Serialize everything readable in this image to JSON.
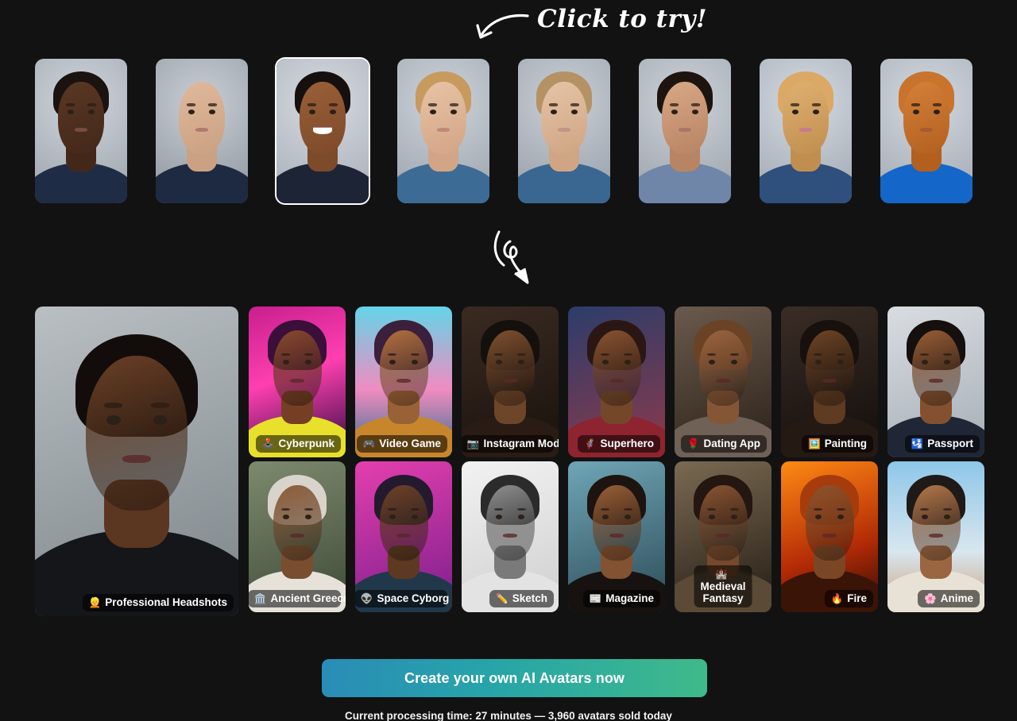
{
  "hint": {
    "text": "Click to try!",
    "arrow_icon": "curved-arrow-left-down-icon",
    "down_arrow_icon": "curly-arrow-down-icon"
  },
  "thumbnails": [
    {
      "name": "man-dark-skin-navy-tee",
      "selected": false,
      "bg1": "#cfd4da",
      "bg2": "#9aa2ab",
      "skin": "#5a3723",
      "skin2": "#43281a",
      "hair": "#1b1310",
      "shirt": "#1f2c45",
      "mouth": "#7a4a46",
      "smile": false
    },
    {
      "name": "man-blond-navy-tee",
      "selected": false,
      "bg1": "#c9ced5",
      "bg2": "#8d949d",
      "skin": "#e0b89b",
      "skin2": "#caa182",
      "hair": "#a5impossible",
      "shirt": "#1d2a42",
      "mouth": "#b07a6e",
      "smile": false
    },
    {
      "name": "woman-afro-smiling-navy",
      "selected": true,
      "bg1": "#d6dae0",
      "bg2": "#a6adb6",
      "skin": "#9a5f38",
      "skin2": "#7d4a2a",
      "hair": "#15100e",
      "shirt": "#1c2436",
      "mouth": "#ffffff",
      "smile": true
    },
    {
      "name": "woman-blonde-blue-tee",
      "selected": false,
      "bg1": "#cdd3da",
      "bg2": "#99a1ab",
      "skin": "#e8c3a6",
      "skin2": "#d2a586",
      "hair": "#c79a5e",
      "shirt": "#3c6b96",
      "mouth": "#c08878",
      "smile": false
    },
    {
      "name": "woman-asian-blue-tee",
      "selected": false,
      "bg1": "#c9cfd6",
      "bg2": "#959da7",
      "skin": "#e5c4a6",
      "skin2": "#cfa583",
      "hair": "#b59264",
      "shirt": "#3a6791",
      "mouth": "#c59485",
      "smile": false
    },
    {
      "name": "couple-split-portrait",
      "selected": false,
      "bg1": "#cdd2d8",
      "bg2": "#9aa1aa",
      "skin": "#d8a886",
      "skin2": "#b88463",
      "hair": "#1d1410",
      "shirt": "#6f86a8",
      "mouth": "#ab7566",
      "smile": false
    },
    {
      "name": "golden-retriever-dog",
      "selected": false,
      "bg1": "#d5dae1",
      "bg2": "#9ea6b0",
      "skin": "#e0b071",
      "skin2": "#c08f50",
      "hair": "#dba965",
      "shirt": "#2f4f7c",
      "mouth": "#c87b8f",
      "smile": false
    },
    {
      "name": "orange-tabby-cat",
      "selected": false,
      "bg1": "#d3d8de",
      "bg2": "#a0a8b2",
      "skin": "#d4803a",
      "skin2": "#b3601f",
      "hair": "#c9732c",
      "shirt": "#1466c9",
      "mouth": "#a65a34",
      "smile": false
    }
  ],
  "gallery": {
    "tiles": [
      {
        "label": "Professional Headshots",
        "emoji": "👱",
        "name": "style-professional-headshots",
        "wrap": false
      },
      {
        "label": "Cyberpunk",
        "emoji": "🕹️",
        "name": "style-cyberpunk",
        "wrap": false
      },
      {
        "label": "Video Game",
        "emoji": "🎮",
        "name": "style-video-game",
        "wrap": false
      },
      {
        "label": "Instagram Model",
        "emoji": "📷",
        "name": "style-instagram-model",
        "wrap": false
      },
      {
        "label": "Superhero",
        "emoji": "🦸",
        "name": "style-superhero",
        "wrap": false
      },
      {
        "label": "Dating App",
        "emoji": "🌹",
        "name": "style-dating-app",
        "wrap": false
      },
      {
        "label": "Painting",
        "emoji": "🖼️",
        "name": "style-painting",
        "wrap": false
      },
      {
        "label": "Passport",
        "emoji": "🛂",
        "name": "style-passport",
        "wrap": false
      },
      {
        "label": "Ancient Greece",
        "emoji": "🏛️",
        "name": "style-ancient-greece",
        "wrap": false
      },
      {
        "label": "Space Cyborg",
        "emoji": "👽",
        "name": "style-space-cyborg",
        "wrap": false
      },
      {
        "label": "Sketch",
        "emoji": "✏️",
        "name": "style-sketch",
        "wrap": false
      },
      {
        "label": "Magazine",
        "emoji": "📰",
        "name": "style-magazine",
        "wrap": false
      },
      {
        "label": "Medieval Fantasy",
        "emoji": "🏰",
        "name": "style-medieval-fantasy",
        "wrap": true
      },
      {
        "label": "Fire",
        "emoji": "🔥",
        "name": "style-fire",
        "wrap": false
      },
      {
        "label": "Anime",
        "emoji": "🌸",
        "name": "style-anime",
        "wrap": false
      }
    ]
  },
  "footer": {
    "cta_label": "Create your own AI Avatars now",
    "note": "Current processing time: 27 minutes — 3,960 avatars sold today",
    "cta_gradient_from": "#2a8cb7",
    "cta_gradient_to": "#3fba8a"
  }
}
